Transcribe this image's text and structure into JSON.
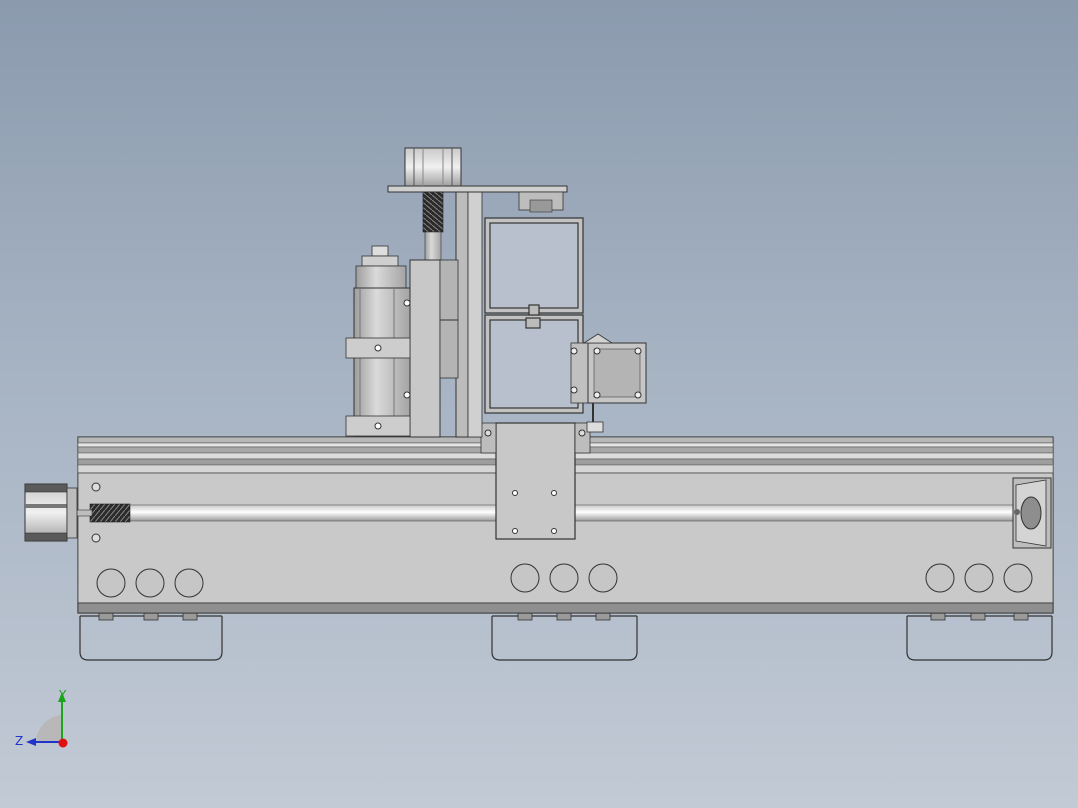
{
  "viewport": {
    "background_top": "#8b9aae",
    "background_bottom": "#c2cad5"
  },
  "model": {
    "description_icon": "cnc-linear-gantry-module"
  },
  "triad": {
    "y_label": "Y",
    "z_label": "Z",
    "colors": {
      "y": "#1aa51a",
      "z": "#2233cc",
      "x": "#e01010"
    }
  }
}
